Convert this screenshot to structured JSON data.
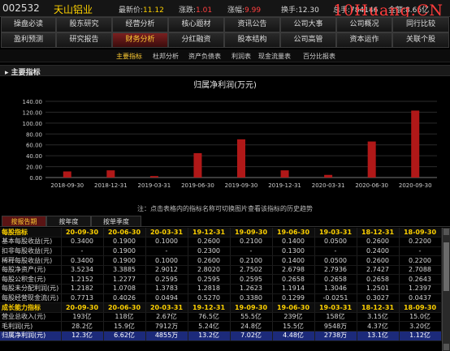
{
  "header": {
    "code": "002532",
    "name": "天山铝业",
    "fields": [
      {
        "label": "最新价:",
        "value": "11.12",
        "color": "#ffd200"
      },
      {
        "label": "涨跌:",
        "value": "1.01",
        "color": "#ff4040"
      },
      {
        "label": "涨幅:",
        "value": "9.99",
        "color": "#ff4040"
      },
      {
        "label": "换手:",
        "value": "12.30",
        "color": "#dcdcdc"
      },
      {
        "label": "总手:",
        "value": "784146",
        "color": "#dcdcdc"
      },
      {
        "label": "金额:",
        "value": "8.66亿",
        "color": "#dcdcdc"
      }
    ],
    "watermark": "10Huang.CN"
  },
  "nav1": [
    "操盘必读",
    "股东研究",
    "经营分析",
    "核心题材",
    "资讯公告",
    "公司大事",
    "公司概况",
    "同行比较"
  ],
  "nav2": [
    "盈利预测",
    "研究报告",
    "财务分析",
    "分红融资",
    "股本结构",
    "公司高管",
    "资本运作",
    "关联个股"
  ],
  "nav2_active": 2,
  "subnav": {
    "items": [
      "主要指标",
      "杜邦分析",
      "资产负债表",
      "利润表",
      "现金流量表",
      "百分比报表"
    ],
    "active": 0
  },
  "section_title": "主要指标",
  "chart_data": {
    "type": "bar",
    "title": "归属净利润(万元)",
    "categories": [
      "2018-09-30",
      "2018-12-31",
      "2019-03-31",
      "2019-06-30",
      "2019-09-30",
      "2019-12-31",
      "2020-03-31",
      "2020-06-30",
      "2020-09-30"
    ],
    "values": [
      11.2,
      13.2,
      2.74,
      44.8,
      70.2,
      13.2,
      4.86,
      66.2,
      123
    ],
    "ylim": [
      0,
      140
    ],
    "yticks": [
      "0.00",
      "20.00",
      "40.00",
      "60.00",
      "80.00",
      "100.00",
      "120.00",
      "140.00"
    ],
    "color": "#b01818",
    "grid": true
  },
  "hint": "注：点击表格内的指标名称可切换图片查看该指标的历史趋势",
  "tabs": {
    "items": [
      "按报告期",
      "按年度",
      "按单季度"
    ],
    "active": 0
  },
  "table": {
    "periods": [
      "20-09-30",
      "20-06-30",
      "20-03-31",
      "19-12-31",
      "19-09-30",
      "19-06-30",
      "19-03-31",
      "18-12-31",
      "18-09-30"
    ],
    "groups": [
      {
        "title": "每股指标",
        "rows": [
          [
            "基本每股收益(元)",
            "0.3400",
            "0.1900",
            "0.1000",
            "0.2600",
            "0.2100",
            "0.1400",
            "0.0500",
            "0.2600",
            "0.2200"
          ],
          [
            "扣非每股收益(元)",
            "-",
            "0.1900",
            "-",
            "0.2300",
            "-",
            "0.1300",
            "-",
            "0.2400",
            "-"
          ],
          [
            "稀释每股收益(元)",
            "0.3400",
            "0.1900",
            "0.1000",
            "0.2600",
            "0.2100",
            "0.1400",
            "0.0500",
            "0.2600",
            "0.2200"
          ],
          [
            "每股净资产(元)",
            "3.5234",
            "3.3885",
            "2.9012",
            "2.8020",
            "2.7502",
            "2.6798",
            "2.7936",
            "2.7427",
            "2.7088"
          ],
          [
            "每股公积金(元)",
            "1.2152",
            "1.2277",
            "0.2595",
            "0.2595",
            "0.2595",
            "0.2658",
            "0.2658",
            "0.2658",
            "0.2643"
          ],
          [
            "每股未分配利润(元)",
            "1.2182",
            "1.0708",
            "1.3783",
            "1.2818",
            "1.2623",
            "1.1914",
            "1.3046",
            "1.2501",
            "1.2397"
          ],
          [
            "每股经营现金流(元)",
            "0.7713",
            "0.4026",
            "0.0494",
            "0.5270",
            "0.3380",
            "0.1299",
            "-0.0251",
            "0.3027",
            "0.0437"
          ]
        ]
      },
      {
        "title": "成长能力指标",
        "rows": [
          [
            "营业总收入(元)",
            "193亿",
            "118亿",
            "2.67亿",
            "76.5亿",
            "55.5亿",
            "239亿",
            "158亿",
            "3.15亿",
            "15.0亿",
            "11.1亿"
          ],
          [
            "毛利润(元)",
            "28.2亿",
            "15.9亿",
            "7912万",
            "5.24亿",
            "24.8亿",
            "15.5亿",
            "9548万",
            "4.37亿",
            "3.20亿"
          ],
          [
            "归属净利润(元)",
            "12.3亿",
            "6.62亿",
            "4855万",
            "13.2亿",
            "7.02亿",
            "4.48亿",
            "2738万",
            "13.1亿",
            "1.12亿"
          ]
        ]
      }
    ],
    "selected_row": "归属净利润(元)"
  }
}
